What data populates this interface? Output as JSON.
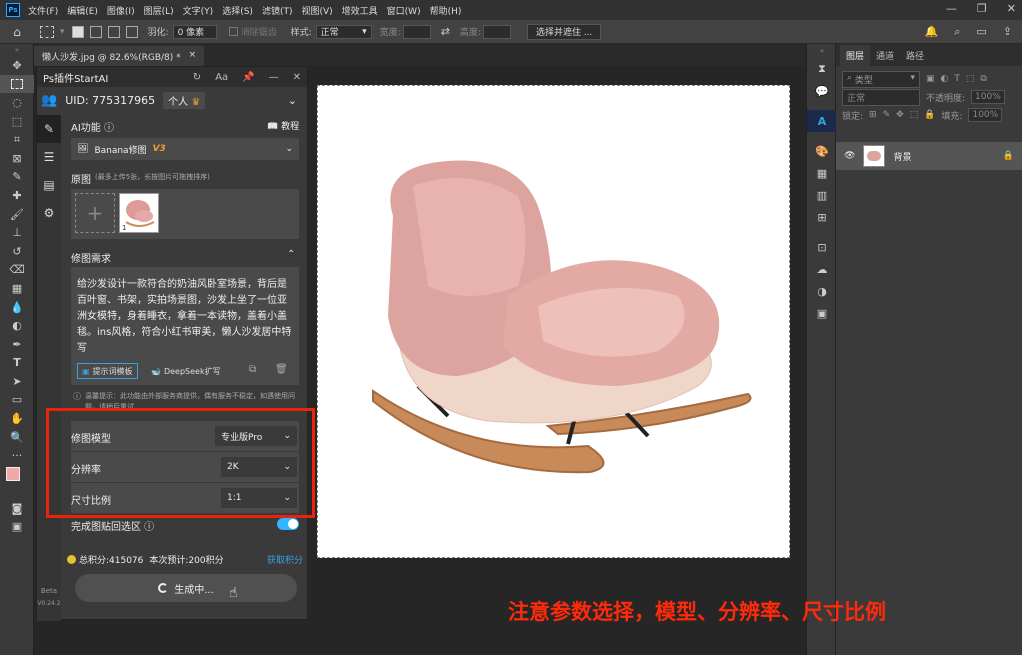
{
  "menubar": {
    "app_icon": "Ps",
    "items": [
      "文件(F)",
      "编辑(E)",
      "图像(I)",
      "图层(L)",
      "文字(Y)",
      "选择(S)",
      "滤镜(T)",
      "视图(V)",
      "增效工具",
      "窗口(W)",
      "帮助(H)"
    ],
    "controls": [
      "—",
      "❐",
      "✕"
    ]
  },
  "options": {
    "feather_label": "羽化:",
    "feather_value": "0 像素",
    "antialias_label": "消除锯齿",
    "style_label": "样式:",
    "style_value": "正常",
    "width_label": "宽度:",
    "height_label": "高度:",
    "select_mask_button": "选择并遮住 ..."
  },
  "document_tab": {
    "title": "懒人沙发.jpg @ 82.6%(RGB/8) *",
    "close": "×"
  },
  "plugin": {
    "title": "Ps插件StartAI",
    "uid_label": "UID: 775317965",
    "account_type": "个人",
    "ai_function_label": "AI功能 ⓘ",
    "tutorial_label": "教程",
    "function_value": "Banana修图",
    "function_version": "V3",
    "source_label": "原图",
    "source_hint": "(最多上传5张，长按图片可拖拽排序)",
    "thumb_index": "1",
    "requirement_label": "修图需求",
    "prompt_text": "给沙发设计一款符合的奶油风卧室场景，背后是百叶窗、书架，实拍场景图，沙发上坐了一位亚洲女模特，身着睡衣，拿着一本读物，盖着小盖毯。ins风格，符合小红书审美，懒人沙发居中特写",
    "prompt_template_button": "提示词模板",
    "deepseek_button": "DeepSeek扩写",
    "notice_text": "温馨提示：此功能由外部服务商提供，偶有服务不稳定，如遇使用问题，请稍后重试",
    "model_label": "修图模型",
    "model_value": "专业版Pro",
    "resolution_label": "分辨率",
    "resolution_value": "2K",
    "ratio_label": "尺寸比例",
    "ratio_value": "1:1",
    "paste_label": "完成图贴回选区 ⓘ",
    "points_text": "总积分:415076",
    "estimate_text": "本次预计:200积分",
    "get_points_link": "获取积分",
    "generate_button": "生成中...",
    "beta_label": "Beta",
    "version_label": "V0.24.2"
  },
  "layers": {
    "tabs": [
      "图层",
      "通道",
      "路径"
    ],
    "filter_label": "类型",
    "blend_mode": "正常",
    "opacity_label": "不透明度:",
    "opacity_value": "100%",
    "lock_label": "锁定:",
    "fill_label": "填充:",
    "fill_value": "100%",
    "layer_name": "背景"
  },
  "caption": "注意参数选择，模型、分辨率、尺寸比例",
  "colors": {
    "highlight": "#e8240b",
    "caption": "#ff2a0a",
    "accent": "#3aa0e0",
    "toggle": "#31b5ff"
  }
}
